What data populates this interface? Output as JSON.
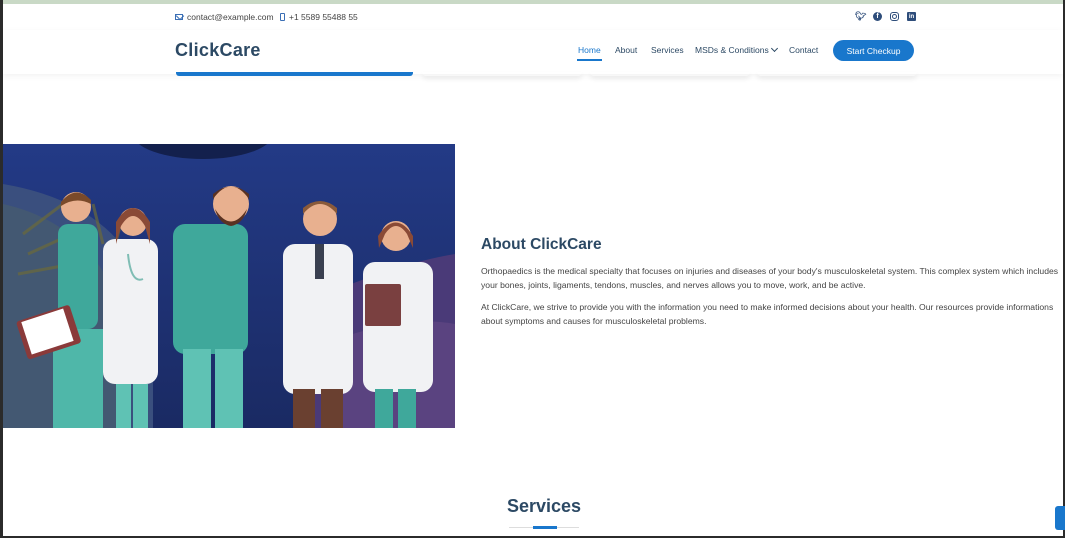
{
  "topbar": {
    "email": "contact@example.com",
    "phone": "+1 5589 55488 55",
    "socials": [
      "twitter-icon",
      "facebook-icon",
      "instagram-icon",
      "linkedin-icon"
    ]
  },
  "header": {
    "logo": "ClickCare",
    "nav": {
      "home": "Home",
      "about": "About",
      "services": "Services",
      "msds": "MSDs & Conditions",
      "contact": "Contact"
    },
    "cta": "Start Checkup"
  },
  "about": {
    "title": "About ClickCare",
    "paragraph1": "Orthopaedics is the medical specialty that focuses on injuries and diseases of your body's musculoskeletal system. This complex system which includes your bones, joints, ligaments, tendons, muscles, and nerves allows you to move, work, and be active.",
    "paragraph2": "At ClickCare, we strive to provide you with the information you need to make informed decisions about your health. Our resources provide informations about symptoms and causes for musculoskeletal problems."
  },
  "services": {
    "title": "Services"
  },
  "colors": {
    "accent": "#1977cc",
    "heading": "#2c4964",
    "scrub_teal": "#3fa89b",
    "background_navy": "#1f2f6e"
  }
}
